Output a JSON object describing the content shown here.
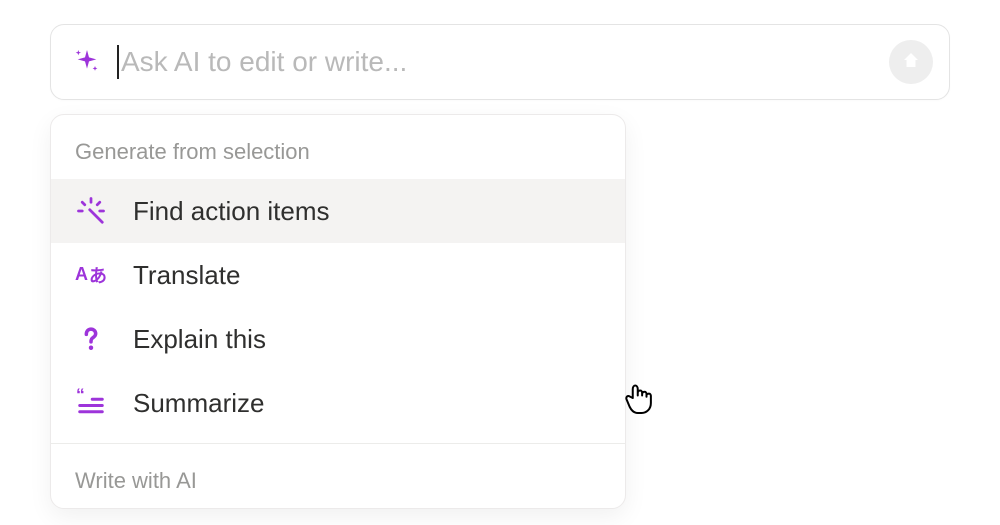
{
  "colors": {
    "accent": "#9d34da",
    "text": "#2f2f2e",
    "muted": "#989896",
    "placeholder": "#b9b9b9",
    "submit_bg": "#eeeeee",
    "submit_arrow": "#ffffff"
  },
  "input": {
    "placeholder": "Ask AI to edit or write...",
    "value": ""
  },
  "menu": {
    "sections": [
      {
        "header": "Generate from selection",
        "items": [
          {
            "id": "find-action-items",
            "label": "Find action items",
            "icon": "magic-wand-icon",
            "highlighted": true
          },
          {
            "id": "translate",
            "label": "Translate",
            "icon": "translate-icon",
            "highlighted": false
          },
          {
            "id": "explain-this",
            "label": "Explain this",
            "icon": "question-icon",
            "highlighted": false
          },
          {
            "id": "summarize",
            "label": "Summarize",
            "icon": "summarize-icon",
            "highlighted": false
          }
        ]
      },
      {
        "header": "Write with AI",
        "items": []
      }
    ]
  }
}
